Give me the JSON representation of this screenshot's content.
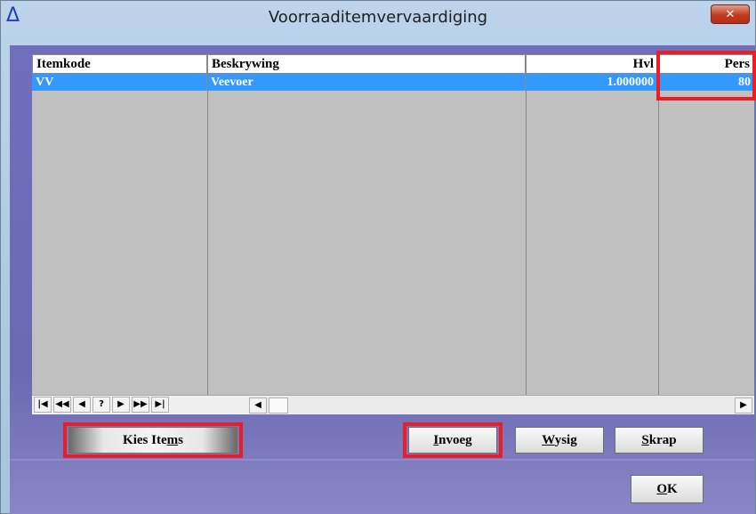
{
  "window": {
    "title": "Voorraaditemvervaardiging",
    "app_icon": "delta-icon",
    "close_label": "x"
  },
  "grid": {
    "columns": [
      "Itemkode",
      "Beskrywing",
      "Hvl",
      "Pers"
    ],
    "rows": [
      {
        "itemkode": "VV",
        "beskrywing": "Veevoer",
        "hvl": "1.000000",
        "pers": "80"
      }
    ]
  },
  "navigator": {
    "buttons": [
      "|◀",
      "◀◀",
      "◀",
      "?",
      "▶",
      "▶▶",
      "▶|"
    ],
    "scroll_left": "◀",
    "scroll_right": "▶"
  },
  "buttons": {
    "kies_items": {
      "pre": "Kies Ite",
      "underline": "m",
      "post": "s"
    },
    "invoeg": {
      "pre": "",
      "underline": "I",
      "post": "nvoeg"
    },
    "wysig": {
      "pre": "",
      "underline": "W",
      "post": "ysig"
    },
    "skrap": {
      "pre": "",
      "underline": "S",
      "post": "krap"
    },
    "ok": {
      "pre": "",
      "underline": "O",
      "post": "K"
    }
  },
  "highlight_color": "#ee1c25",
  "selection_color": "#3399ff"
}
